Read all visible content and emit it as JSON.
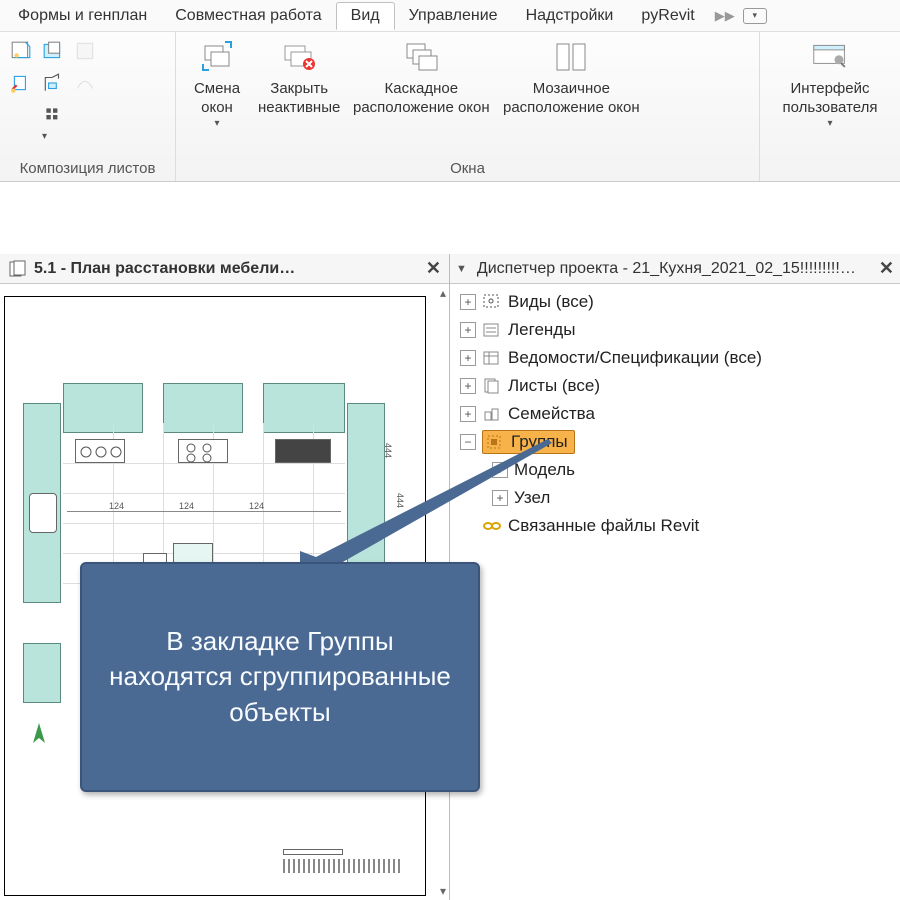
{
  "ribbon": {
    "tabs": {
      "forms": "Формы и генплан",
      "collab": "Совместная работа",
      "view": "Вид",
      "manage": "Управление",
      "addins": "Надстройки",
      "pyrevit": "pyRevit"
    },
    "groups": {
      "sheet_composition": "Композиция листов",
      "windows": "Окна"
    },
    "buttons": {
      "switch_windows": "Смена\nокон",
      "close_inactive": "Закрыть\nнеактивные",
      "cascade": "Каскадное\nрасположение окон",
      "tile": "Мозаичное\nрасположение окон",
      "ui": "Интерфейс\nпользователя"
    }
  },
  "viewTab": {
    "label": "5.1 - План расстановки мебели…"
  },
  "browser": {
    "title": "Диспетчер проекта - 21_Кухня_2021_02_15!!!!!!!!!…",
    "items": {
      "views": "Виды (все)",
      "legends": "Легенды",
      "schedules": "Ведомости/Спецификации (все)",
      "sheets": "Листы (все)",
      "families": "Семейства",
      "groups": "Группы",
      "model": "Модель",
      "detail": "Узел",
      "links": "Связанные файлы Revit"
    }
  },
  "dims": {
    "a": "124",
    "b": "124",
    "c": "124",
    "side": "444",
    "side2": "444"
  },
  "callout": {
    "text": "В закладке Группы находятся сгруппированные объекты"
  }
}
